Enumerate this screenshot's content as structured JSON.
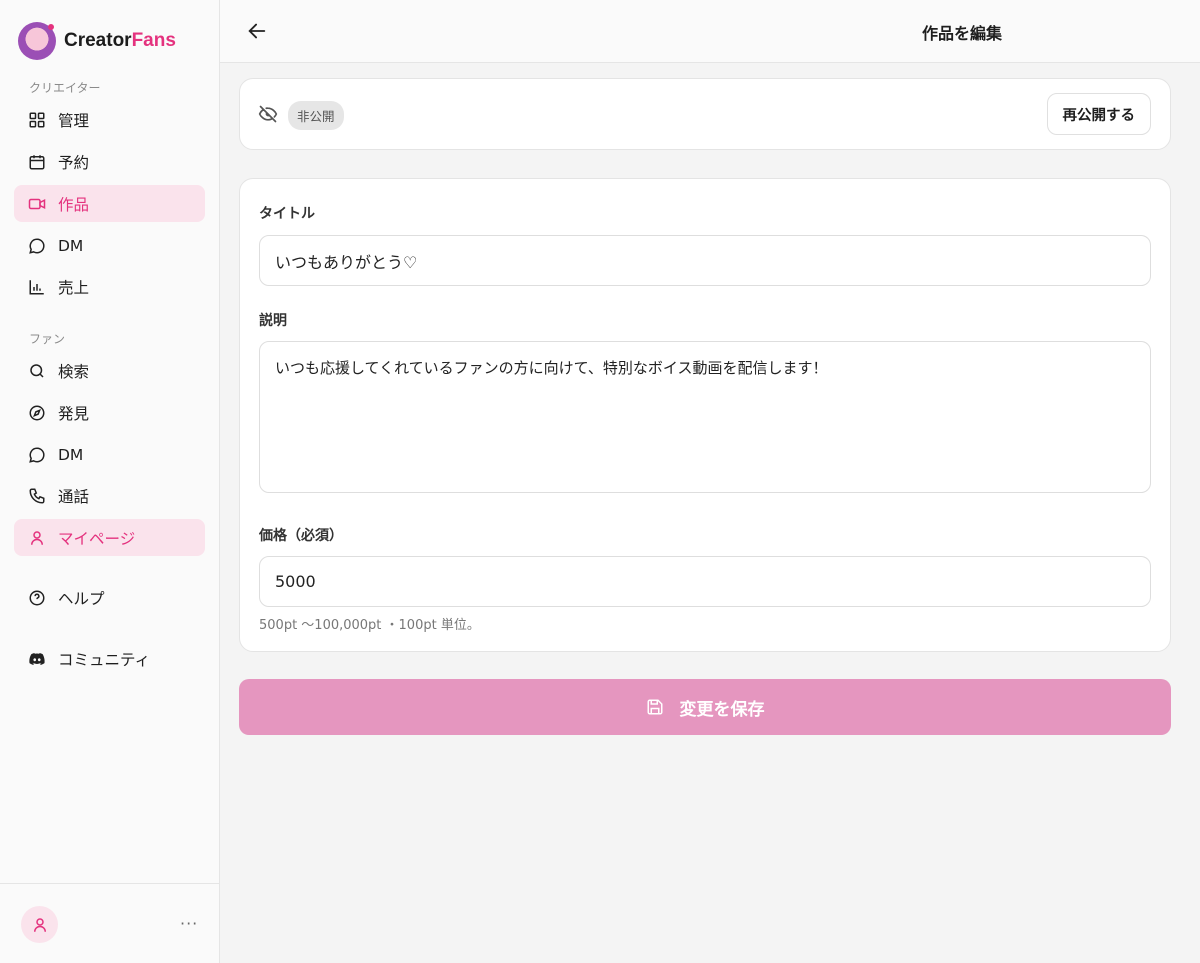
{
  "brand": {
    "name_part1": "Creator",
    "name_part2": "Fans"
  },
  "sidebar": {
    "creator_label": "クリエイター",
    "creator_items": [
      {
        "label": "管理",
        "icon": "grid-icon"
      },
      {
        "label": "予約",
        "icon": "calendar-icon"
      },
      {
        "label": "作品",
        "icon": "video-icon",
        "active": true
      },
      {
        "label": "DM",
        "icon": "chat-icon"
      },
      {
        "label": "売上",
        "icon": "bar-chart-icon"
      }
    ],
    "fan_label": "ファン",
    "fan_items": [
      {
        "label": "検索",
        "icon": "search-icon"
      },
      {
        "label": "発見",
        "icon": "compass-icon"
      },
      {
        "label": "DM",
        "icon": "chat-icon"
      },
      {
        "label": "通話",
        "icon": "phone-icon"
      },
      {
        "label": "マイページ",
        "icon": "user-icon",
        "active": true
      }
    ],
    "help": {
      "label": "ヘルプ",
      "icon": "help-circle-icon"
    },
    "community": {
      "label": "コミュニティ",
      "icon": "discord-icon"
    },
    "more": "···"
  },
  "header": {
    "title": "作品を編集"
  },
  "status": {
    "badge": "非公開",
    "republish_label": "再公開する"
  },
  "form": {
    "title_label": "タイトル",
    "title_value": "いつもありがとう♡",
    "description_label": "説明",
    "description_value": "いつも応援してくれているファンの方に向けて、特別なボイス動画を配信します！",
    "price_label": "価格（必須）",
    "price_value": "5000",
    "price_hint": "500pt 〜100,000pt ・100pt 単位。"
  },
  "save_label": "変更を保存",
  "colors": {
    "accent": "#e4327e",
    "active_bg": "#fae3ec",
    "save_button": "#e596bf"
  }
}
